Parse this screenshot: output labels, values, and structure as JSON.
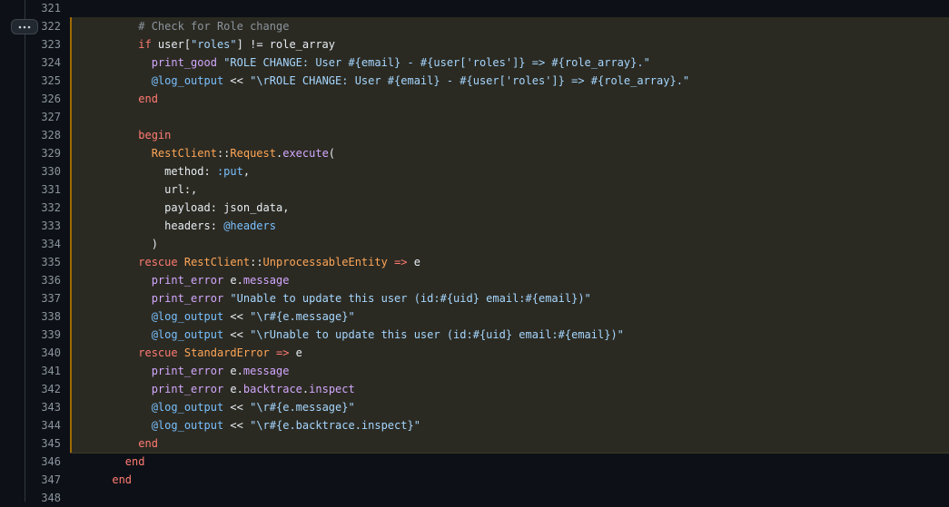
{
  "editor": {
    "expand_button": {
      "icon": "kebab-horizontal-icon"
    },
    "colors": {
      "keyword": "#ff7b72",
      "string": "#a5d6ff",
      "constant": "#ffa657",
      "function": "#d2a8ff",
      "ivar": "#79c0ff",
      "comment": "#8b949e",
      "plain": "#e6edf3",
      "highlight_bg": "#2b2a22",
      "highlight_bar": "#9e6a03",
      "line_number": "#8b949e"
    },
    "lines": [
      {
        "num": "321",
        "hl": false,
        "indent": "",
        "tokens": []
      },
      {
        "num": "322",
        "hl": true,
        "indent": "          ",
        "tokens": [
          [
            "comment",
            "# Check for Role change"
          ]
        ]
      },
      {
        "num": "323",
        "hl": true,
        "indent": "          ",
        "tokens": [
          [
            "keyword",
            "if"
          ],
          [
            "plain",
            " user["
          ],
          [
            "string",
            "\"roles\""
          ],
          [
            "plain",
            "] != role_array"
          ]
        ]
      },
      {
        "num": "324",
        "hl": true,
        "indent": "            ",
        "tokens": [
          [
            "function",
            "print_good"
          ],
          [
            "plain",
            " "
          ],
          [
            "string",
            "\"ROLE CHANGE: User #{email} - #{user['roles']} => #{role_array}.\""
          ]
        ]
      },
      {
        "num": "325",
        "hl": true,
        "indent": "            ",
        "tokens": [
          [
            "ivar",
            "@log_output"
          ],
          [
            "plain",
            " << "
          ],
          [
            "string",
            "\"\\rROLE CHANGE: User #{email} - #{user['roles']} => #{role_array}.\""
          ]
        ]
      },
      {
        "num": "326",
        "hl": true,
        "indent": "          ",
        "tokens": [
          [
            "keyword",
            "end"
          ]
        ]
      },
      {
        "num": "327",
        "hl": true,
        "indent": "",
        "tokens": []
      },
      {
        "num": "328",
        "hl": true,
        "indent": "          ",
        "tokens": [
          [
            "keyword",
            "begin"
          ]
        ]
      },
      {
        "num": "329",
        "hl": true,
        "indent": "            ",
        "tokens": [
          [
            "constant",
            "RestClient"
          ],
          [
            "plain",
            "::"
          ],
          [
            "constant",
            "Request"
          ],
          [
            "plain",
            "."
          ],
          [
            "function",
            "execute"
          ],
          [
            "plain",
            "("
          ]
        ]
      },
      {
        "num": "330",
        "hl": true,
        "indent": "              ",
        "tokens": [
          [
            "plain",
            "method: "
          ],
          [
            "ivar",
            ":put"
          ],
          [
            "plain",
            ","
          ]
        ]
      },
      {
        "num": "331",
        "hl": true,
        "indent": "              ",
        "tokens": [
          [
            "plain",
            "url:,"
          ]
        ]
      },
      {
        "num": "332",
        "hl": true,
        "indent": "              ",
        "tokens": [
          [
            "plain",
            "payload: json_data,"
          ]
        ]
      },
      {
        "num": "333",
        "hl": true,
        "indent": "              ",
        "tokens": [
          [
            "plain",
            "headers: "
          ],
          [
            "ivar",
            "@headers"
          ]
        ]
      },
      {
        "num": "334",
        "hl": true,
        "indent": "            ",
        "tokens": [
          [
            "plain",
            ")"
          ]
        ]
      },
      {
        "num": "335",
        "hl": true,
        "indent": "          ",
        "tokens": [
          [
            "keyword",
            "rescue"
          ],
          [
            "plain",
            " "
          ],
          [
            "constant",
            "RestClient"
          ],
          [
            "plain",
            "::"
          ],
          [
            "constant",
            "UnprocessableEntity"
          ],
          [
            "plain",
            " "
          ],
          [
            "keyword",
            "=>"
          ],
          [
            "plain",
            " e"
          ]
        ]
      },
      {
        "num": "336",
        "hl": true,
        "indent": "            ",
        "tokens": [
          [
            "function",
            "print_error"
          ],
          [
            "plain",
            " e."
          ],
          [
            "function",
            "message"
          ]
        ]
      },
      {
        "num": "337",
        "hl": true,
        "indent": "            ",
        "tokens": [
          [
            "function",
            "print_error"
          ],
          [
            "plain",
            " "
          ],
          [
            "string",
            "\"Unable to update this user (id:#{uid} email:#{email})\""
          ]
        ]
      },
      {
        "num": "338",
        "hl": true,
        "indent": "            ",
        "tokens": [
          [
            "ivar",
            "@log_output"
          ],
          [
            "plain",
            " << "
          ],
          [
            "string",
            "\"\\r#{e.message}\""
          ]
        ]
      },
      {
        "num": "339",
        "hl": true,
        "indent": "            ",
        "tokens": [
          [
            "ivar",
            "@log_output"
          ],
          [
            "plain",
            " << "
          ],
          [
            "string",
            "\"\\rUnable to update this user (id:#{uid} email:#{email})\""
          ]
        ]
      },
      {
        "num": "340",
        "hl": true,
        "indent": "          ",
        "tokens": [
          [
            "keyword",
            "rescue"
          ],
          [
            "plain",
            " "
          ],
          [
            "constant",
            "StandardError"
          ],
          [
            "plain",
            " "
          ],
          [
            "keyword",
            "=>"
          ],
          [
            "plain",
            " e"
          ]
        ]
      },
      {
        "num": "341",
        "hl": true,
        "indent": "            ",
        "tokens": [
          [
            "function",
            "print_error"
          ],
          [
            "plain",
            " e."
          ],
          [
            "function",
            "message"
          ]
        ]
      },
      {
        "num": "342",
        "hl": true,
        "indent": "            ",
        "tokens": [
          [
            "function",
            "print_error"
          ],
          [
            "plain",
            " e."
          ],
          [
            "function",
            "backtrace"
          ],
          [
            "plain",
            "."
          ],
          [
            "function",
            "inspect"
          ]
        ]
      },
      {
        "num": "343",
        "hl": true,
        "indent": "            ",
        "tokens": [
          [
            "ivar",
            "@log_output"
          ],
          [
            "plain",
            " << "
          ],
          [
            "string",
            "\"\\r#{e.message}\""
          ]
        ]
      },
      {
        "num": "344",
        "hl": true,
        "indent": "            ",
        "tokens": [
          [
            "ivar",
            "@log_output"
          ],
          [
            "plain",
            " << "
          ],
          [
            "string",
            "\"\\r#{e.backtrace.inspect}\""
          ]
        ]
      },
      {
        "num": "345",
        "hl": true,
        "indent": "          ",
        "tokens": [
          [
            "keyword",
            "end"
          ]
        ]
      },
      {
        "num": "346",
        "hl": false,
        "indent": "        ",
        "tokens": [
          [
            "keyword",
            "end"
          ]
        ]
      },
      {
        "num": "347",
        "hl": false,
        "indent": "      ",
        "tokens": [
          [
            "keyword",
            "end"
          ]
        ]
      },
      {
        "num": "348",
        "hl": false,
        "indent": "",
        "tokens": []
      }
    ]
  }
}
